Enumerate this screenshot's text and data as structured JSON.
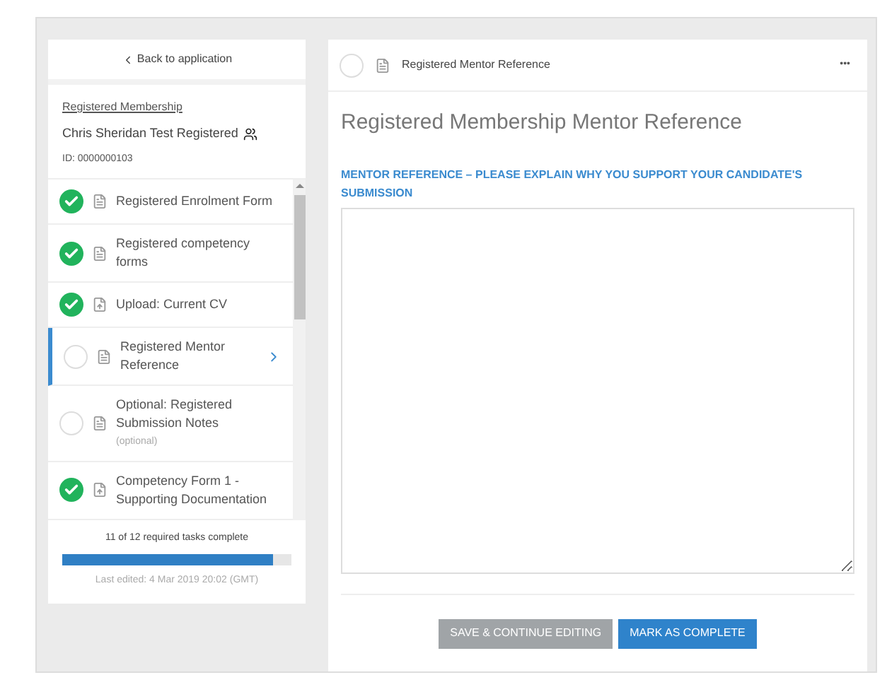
{
  "sidebar": {
    "back_link": "Back to application",
    "application_type": "Registered Membership",
    "applicant": "Chris Sheridan Test Registered",
    "applicant_id": "ID: 0000000103",
    "tasks": [
      {
        "label": "Registered Enrolment Form",
        "kind": "form",
        "complete": true,
        "selected": false
      },
      {
        "label": "Registered competency forms",
        "kind": "form",
        "complete": true,
        "selected": false
      },
      {
        "label": "Upload: Current CV",
        "kind": "upload",
        "complete": true,
        "selected": false
      },
      {
        "label": "Registered Mentor Reference",
        "kind": "form",
        "complete": false,
        "selected": true
      },
      {
        "label": "Optional: Registered Submission Notes",
        "kind": "form",
        "complete": false,
        "selected": false,
        "note": "(optional)"
      },
      {
        "label": "Competency Form 1 - Supporting Documentation",
        "kind": "upload",
        "complete": true,
        "selected": false
      }
    ],
    "progress": {
      "text": "11 of 12 required tasks complete",
      "level": 0.917
    },
    "last_edited": "Last edited: 4 Mar 2019 20:02 (GMT)"
  },
  "main": {
    "header_title": "Registered Mentor Reference",
    "header_complete": false,
    "more": "•••",
    "heading": "Registered Membership Mentor Reference",
    "question": "MENTOR REFERENCE – PLEASE EXPLAIN WHY YOU SUPPORT YOUR CANDIDATE'S SUBMISSION",
    "buttons": [
      {
        "label": "SAVE & CONTINUE EDITING",
        "disabled": true
      },
      {
        "label": "MARK AS COMPLETE",
        "disabled": false
      }
    ]
  }
}
